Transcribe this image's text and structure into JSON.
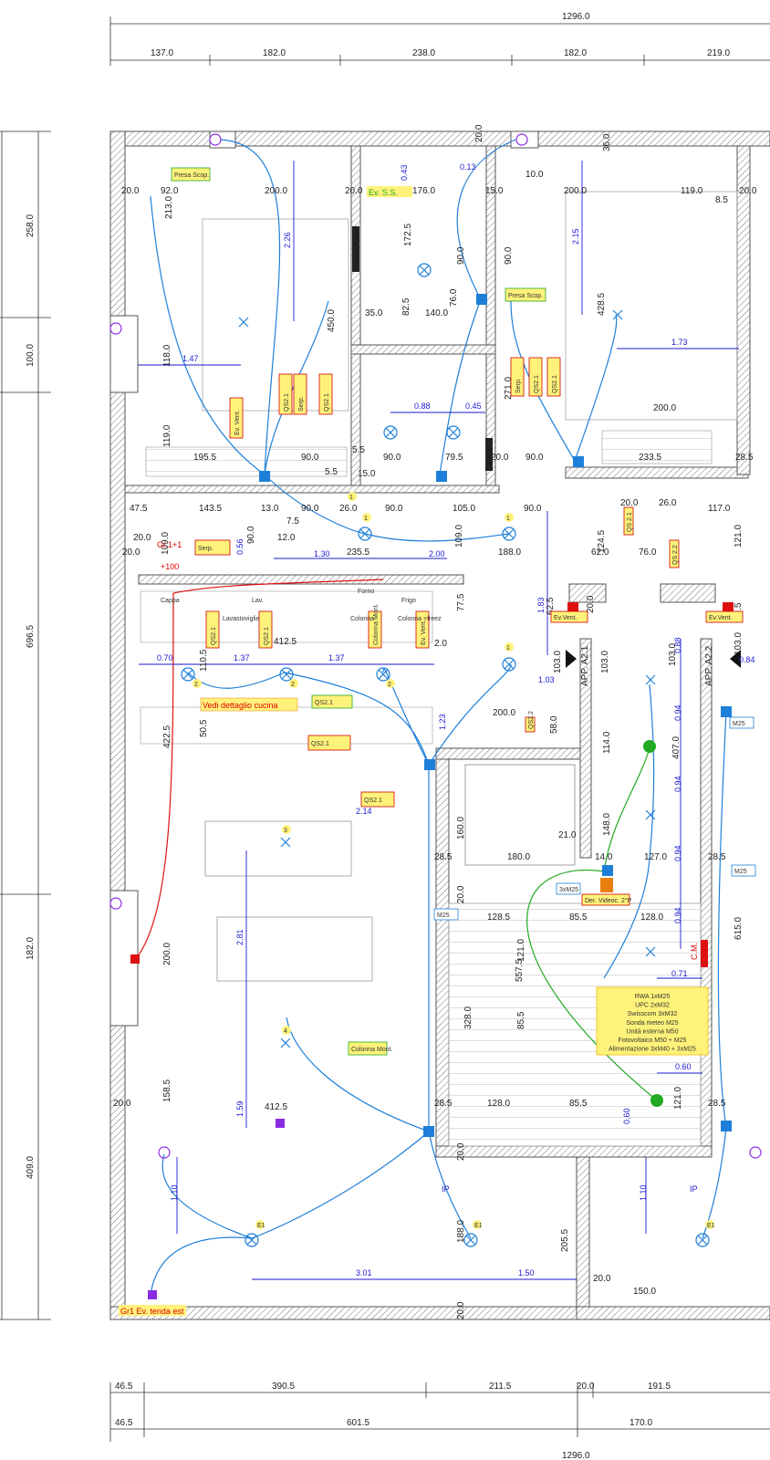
{
  "top_dims": {
    "total": "1296.0",
    "segments": [
      "137.0",
      "182.0",
      "238.0",
      "182.0",
      "219.0"
    ]
  },
  "left_dims": {
    "outer": [
      "258.0",
      "100.0",
      "182.0",
      "409.0"
    ],
    "inner": "696.5"
  },
  "bottom_dims": {
    "row1": [
      "46.5",
      "390.5",
      "211.5",
      "20.0",
      "191.5"
    ],
    "row2": [
      "46.5",
      "601.5",
      "170.0"
    ],
    "total": "1296.0"
  },
  "room_dims": [
    "20.0",
    "92.0",
    "213.0",
    "200.0",
    "20.0",
    "176.0",
    "15.0",
    "200.0",
    "119.0",
    "8.5",
    "20.0",
    "36.0",
    "20.0",
    "10.0",
    "118.0",
    "119.0",
    "450.0",
    "172.5",
    "90.0",
    "90.0",
    "35.0",
    "82.5",
    "140.0",
    "76.0",
    "428.5",
    "271.0",
    "200.0",
    "195.5",
    "90.0",
    "5.5",
    "90.0",
    "79.5",
    "20.0",
    "90.0",
    "233.5",
    "28.5",
    "5.5",
    "15.0",
    "47.5",
    "143.5",
    "13.0",
    "7.5",
    "90.0",
    "26.0",
    "90.0",
    "105.0",
    "90.0",
    "20.0",
    "26.0",
    "117.0",
    "109.0",
    "20.0",
    "20.0",
    "90.0",
    "12.0",
    "235.5",
    "188.0",
    "109.0",
    "124.5",
    "62.0",
    "76.0",
    "121.0",
    "77.5",
    "62.5",
    "62.5",
    "412.5",
    "110.5",
    "422.5",
    "50.5",
    "103.0",
    "103.0",
    "103.0",
    "103.0",
    "20.0",
    "2.0",
    "200.0",
    "58.0",
    "114.0",
    "407.0",
    "148.0",
    "21.0",
    "180.0",
    "28.5",
    "14.0",
    "127.0",
    "28.5",
    "160.0",
    "20.0",
    "128.5",
    "85.5",
    "128.0",
    "615.0",
    "121.0",
    "557.5",
    "200.0",
    "328.0",
    "85.5",
    "121.0",
    "412.5",
    "158.5",
    "20.0",
    "28.5",
    "128.0",
    "85.5",
    "121.0",
    "28.5",
    "20.0",
    "188.0",
    "205.5",
    "20.0",
    "150.0",
    "20.0"
  ],
  "blue_dims": [
    "2.26",
    "1.47",
    "0.43",
    "0.13",
    "2.15",
    "1.73",
    "0.88",
    "0.45",
    "0.56",
    "1.30",
    "2.00",
    "1.83",
    "1.03",
    "0.70",
    "1.37",
    "1.37",
    "1.23",
    "0.88",
    "0.94",
    "0.94",
    "0.94",
    "0.94",
    "0.84",
    "2.14",
    "2.81",
    "1.59",
    "0.71",
    "0.60",
    "0.60",
    "1.10",
    "3.01",
    "1.50",
    "1.10"
  ],
  "cross_labels": [
    "1",
    "1",
    "1",
    "1",
    "2",
    "2",
    "2",
    "3",
    "4",
    "E1",
    "E1",
    "E1"
  ],
  "apt_labels": [
    "APP. A2.1",
    "APP. A2.2"
  ],
  "kitchen_note": "Vedi dettaglio cucina",
  "bottom_note": "Gr1 Ev. tenda est",
  "gr_note": "Gr.1+1",
  "gr_sub": "+100",
  "evss": "Ev. S.S.",
  "cm": "C.M.",
  "ip": [
    "IP",
    "IP"
  ],
  "kitchen_text": [
    "Cappa",
    "Lav.",
    "Forno",
    "Frigo",
    "Lavastoviglie",
    "Colonna",
    "Colonna +freez"
  ],
  "tags_yellow": [
    "QS2.1",
    "Ev. Vent.",
    "Serp.",
    "QS2.1",
    "Serp.",
    "QS2.1",
    "QS2.1",
    "Serp.",
    "QS2.1",
    "QS2.1",
    "Colonna Mont.",
    "Ev. Vent.",
    "QS2.1",
    "QS2.1",
    "QS2.2",
    "QS 2.1",
    "QS 2.2"
  ],
  "tags_green": [
    "Presa Scop.",
    "Presa Scop.",
    "Colonna Mont.",
    "QS2.1"
  ],
  "ev_vent": [
    "Ev.Vent.",
    "Ev.Vent."
  ],
  "der_video": "Der. Videoc. 2°P",
  "m25_labels": [
    "M25",
    "M25",
    "M25",
    "3xM25"
  ],
  "legend": [
    {
      "text": "RWA 1xM25",
      "color": "#ff8800"
    },
    {
      "text": "UPC 2xM32",
      "color": "#7700cc"
    },
    {
      "text": "Swisscom 3xM32",
      "color": "#22b822"
    },
    {
      "text": "Sonda meteo M25",
      "color": "#7700cc"
    },
    {
      "text": "Unità esterna M50",
      "color": "#d00000"
    },
    {
      "text": "Fotovoltaico M50 + M25",
      "color": "#d00000"
    },
    {
      "text": "Alimentazione 3xM40 + 3xM25",
      "color": "#d00000"
    }
  ],
  "colors": {
    "wall": "#555555",
    "blue": "#1e7fd8",
    "dimblue": "#1a1ad0",
    "red": "#dd1111",
    "green": "#22aa22",
    "purple": "#8a2be2",
    "yellow": "#fff27a",
    "orange": "#e88010"
  }
}
